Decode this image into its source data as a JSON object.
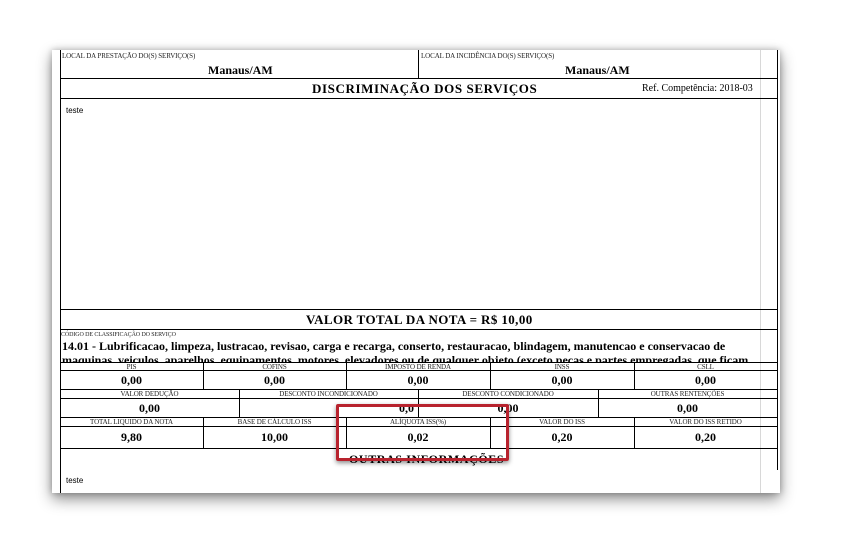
{
  "local_prestacao": {
    "label": "LOCAL DA PRESTAÇÃO DO(S) SERVIÇO(S)",
    "value": "Manaus/AM"
  },
  "local_incidencia": {
    "label": "LOCAL DA INCIDÊNCIA DO(S) SERVIÇO(S)",
    "value": "Manaus/AM"
  },
  "discriminacao": {
    "title": "DISCRIMINAÇÃO DOS SERVIÇOS",
    "ref": "Ref. Competência: 2018-03",
    "text": "teste"
  },
  "valor_total": "VALOR TOTAL DA NOTA = R$ 10,00",
  "servico": {
    "label": "CÓDIGO DE CLASSIFICAÇÃO DO SERVIÇO",
    "line1": "14.01 - Lubrificacao, limpeza, lustracao, revisao, carga e recarga, conserto, restauracao, blindagem, manutencao e conservacao de",
    "line2": "maquinas, veiculos, aparelhos, equipamentos, motores, elevadores ou de qualquer objeto (exceto pecas e partes empregadas, que ficam"
  },
  "tributos": [
    {
      "label": "PIS",
      "value": "0,00"
    },
    {
      "label": "COFINS",
      "value": "0,00"
    },
    {
      "label": "IMPOSTO DE RENDA",
      "value": "0,00"
    },
    {
      "label": "INSS",
      "value": "0,00"
    },
    {
      "label": "CSLL",
      "value": "0,00"
    }
  ],
  "deducoes": [
    {
      "label": "VALOR DEDUÇÃO",
      "value": "0,00"
    },
    {
      "label": "DESCONTO INCONDICIONADO",
      "value": "0,0"
    },
    {
      "label": "DESCONTO CONDICIONADO",
      "value": "0,00"
    },
    {
      "label": "OUTRAS RENTENÇÕES",
      "value": "0,00"
    }
  ],
  "totais": [
    {
      "label": "TOTAL LIQUIDO DA NOTA",
      "value": "9,80"
    },
    {
      "label": "BASE DE CÁLCULO ISS",
      "value": "10,00"
    },
    {
      "label": "ALÍQUOTA ISS(%)",
      "value": "0,02"
    },
    {
      "label": "VALOR DO ISS",
      "value": "0,20"
    },
    {
      "label": "VALOR DO ISS RETIDO",
      "value": "0,20"
    }
  ],
  "outras_informacoes": {
    "title": "OUTRAS INFORMAÇÕES",
    "text": "teste"
  },
  "highlight_color": "#b8232e"
}
